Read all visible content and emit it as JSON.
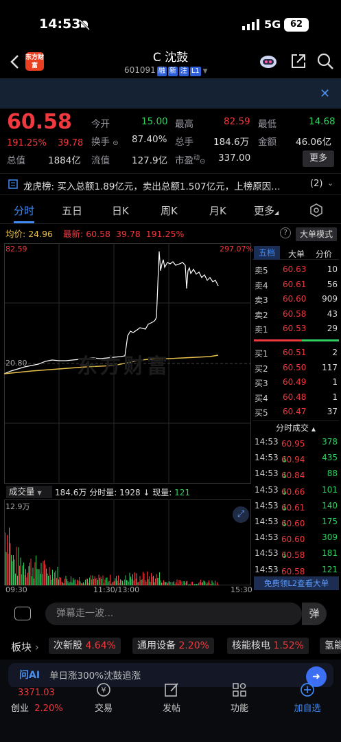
{
  "status": {
    "time": "14:53",
    "network": "5G",
    "battery": "62"
  },
  "header": {
    "logo_text": "东方财富",
    "stock_name": "C 沈鼓",
    "code": "601091",
    "tags": [
      "融",
      "新",
      "注",
      "L1"
    ]
  },
  "quote": {
    "price": "60.58",
    "pct": "191.25%",
    "change": "39.78",
    "open_label": "今开",
    "open": "15.00",
    "high_label": "最高",
    "high": "82.59",
    "low_label": "最低",
    "low": "14.68",
    "turnover_label": "换手",
    "turnover": "87.40%",
    "volume_label": "总手",
    "volume": "184.6万",
    "amount_label": "金额",
    "amount": "46.06亿",
    "mktcap_label": "总值",
    "mktcap": "1884亿",
    "float_label": "流值",
    "float": "127.9亿",
    "pe_label": "市盈",
    "pe_sup": "动",
    "pe": "337.00",
    "more": "更多"
  },
  "dragon": {
    "label": "龙虎榜:",
    "text": "买入总额1.89亿元，卖出总额1.507亿元，上榜原因…",
    "count": "(2)"
  },
  "tabs": [
    "分时",
    "五日",
    "日K",
    "周K",
    "月K",
    "更多"
  ],
  "avg": {
    "avg_label": "均价:",
    "avg": "24.96",
    "latest_label": "最新:",
    "latest": "60.58",
    "chg": "39.78",
    "pct": "191.25%",
    "big_mode": "大单模式"
  },
  "chart_labels": {
    "top_left": "82.59",
    "top_right": "297.07%",
    "mid_left": "20.80",
    "watermark": "东方财富"
  },
  "volume_bar": {
    "label": "成交量",
    "total": "184.6万",
    "min_label": "分时量:",
    "min_val": "1928",
    "now_label": "现量:",
    "now_val": "121",
    "max": "12.9万"
  },
  "time_axis": [
    "09:30",
    "11:30/13:00",
    "15:30"
  ],
  "orderbook_tabs": [
    "五档",
    "大单",
    "分价"
  ],
  "asks": [
    {
      "l": "卖5",
      "p": "60.63",
      "v": "10"
    },
    {
      "l": "卖4",
      "p": "60.61",
      "v": "56"
    },
    {
      "l": "卖3",
      "p": "60.60",
      "v": "909"
    },
    {
      "l": "卖2",
      "p": "60.58",
      "v": "43"
    },
    {
      "l": "卖1",
      "p": "60.53",
      "v": "29"
    }
  ],
  "bids": [
    {
      "l": "买1",
      "p": "60.51",
      "v": "2"
    },
    {
      "l": "买2",
      "p": "60.50",
      "v": "117"
    },
    {
      "l": "买3",
      "p": "60.49",
      "v": "1"
    },
    {
      "l": "买4",
      "p": "60.48",
      "v": "1"
    },
    {
      "l": "买5",
      "p": "60.47",
      "v": "37"
    }
  ],
  "trades_title": "分时成交",
  "trades": [
    {
      "t": "14:53",
      "p": "60.95",
      "d": "",
      "v": "378",
      "c": "green"
    },
    {
      "t": "14:53",
      "p": "60.94",
      "d": "↓",
      "v": "435",
      "c": "green"
    },
    {
      "t": "14:53",
      "p": "60.84",
      "d": "↓",
      "v": "88",
      "c": "green"
    },
    {
      "t": "14:53",
      "p": "60.66",
      "d": "↓",
      "v": "101",
      "c": "green"
    },
    {
      "t": "14:53",
      "p": "60.61",
      "d": "↓",
      "v": "140",
      "c": "green"
    },
    {
      "t": "14:53",
      "p": "60.60",
      "d": "↓",
      "v": "175",
      "c": "green"
    },
    {
      "t": "14:53",
      "p": "60.60",
      "d": "",
      "v": "309",
      "c": "green"
    },
    {
      "t": "14:53",
      "p": "60.58",
      "d": "↓",
      "v": "181",
      "c": "green"
    },
    {
      "t": "14:53",
      "p": "60.58",
      "d": "",
      "v": "121",
      "c": "green"
    }
  ],
  "l2_text": "免费领L2查看大单",
  "comment_placeholder": "弹幕走一波...",
  "danmu": "弹",
  "sectors": {
    "label": "板块",
    "items": [
      {
        "name": "次新股",
        "pct": "4.64%"
      },
      {
        "name": "通用设备",
        "pct": "2.20%"
      },
      {
        "name": "核能核电",
        "pct": "1.52%"
      },
      {
        "name": "氢能",
        "pct": ""
      }
    ]
  },
  "ad_text": "单日涨300%沈鼓追涨",
  "bottom_nav": {
    "index_value": "3371.03",
    "index_name": "创业",
    "index_pct": "2.20%",
    "items": [
      "交易",
      "发帖",
      "功能",
      "加自选"
    ]
  },
  "colors": {
    "up": "#f0383f",
    "down": "#2fd061",
    "accent": "#3d8af7"
  }
}
